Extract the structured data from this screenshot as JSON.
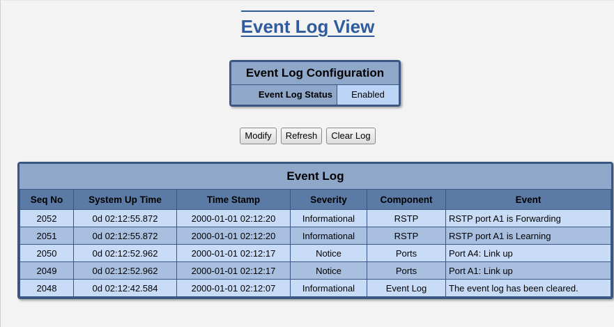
{
  "page": {
    "title": "Event Log View"
  },
  "config": {
    "heading": "Event Log Configuration",
    "status_label": "Event Log Status",
    "status_value": "Enabled"
  },
  "buttons": {
    "modify": "Modify",
    "refresh": "Refresh",
    "clear_log": "Clear Log"
  },
  "event_log": {
    "title": "Event Log",
    "columns": [
      "Seq No",
      "System Up Time",
      "Time Stamp",
      "Severity",
      "Component",
      "Event"
    ],
    "rows": [
      [
        "2052",
        "0d 02:12:55.872",
        "2000-01-01 02:12:20",
        "Informational",
        "RSTP",
        "RSTP port A1 is Forwarding"
      ],
      [
        "2051",
        "0d 02:12:55.872",
        "2000-01-01 02:12:20",
        "Informational",
        "RSTP",
        "RSTP port A1 is Learning"
      ],
      [
        "2050",
        "0d 02:12:52.962",
        "2000-01-01 02:12:17",
        "Notice",
        "Ports",
        "Port A4: Link up"
      ],
      [
        "2049",
        "0d 02:12:52.962",
        "2000-01-01 02:12:17",
        "Notice",
        "Ports",
        "Port A1: Link up"
      ],
      [
        "2048",
        "0d 02:12:42.584",
        "2000-01-01 02:12:07",
        "Informational",
        "Event Log",
        "The event log has been cleared."
      ]
    ]
  },
  "colors": {
    "title": "#2f5a9e",
    "frame": "#3a5683",
    "header": "#8fa7c9",
    "column_header": "#5b7aa6",
    "row_light": "#c9dcf7",
    "row_dark": "#a9bfe0"
  }
}
